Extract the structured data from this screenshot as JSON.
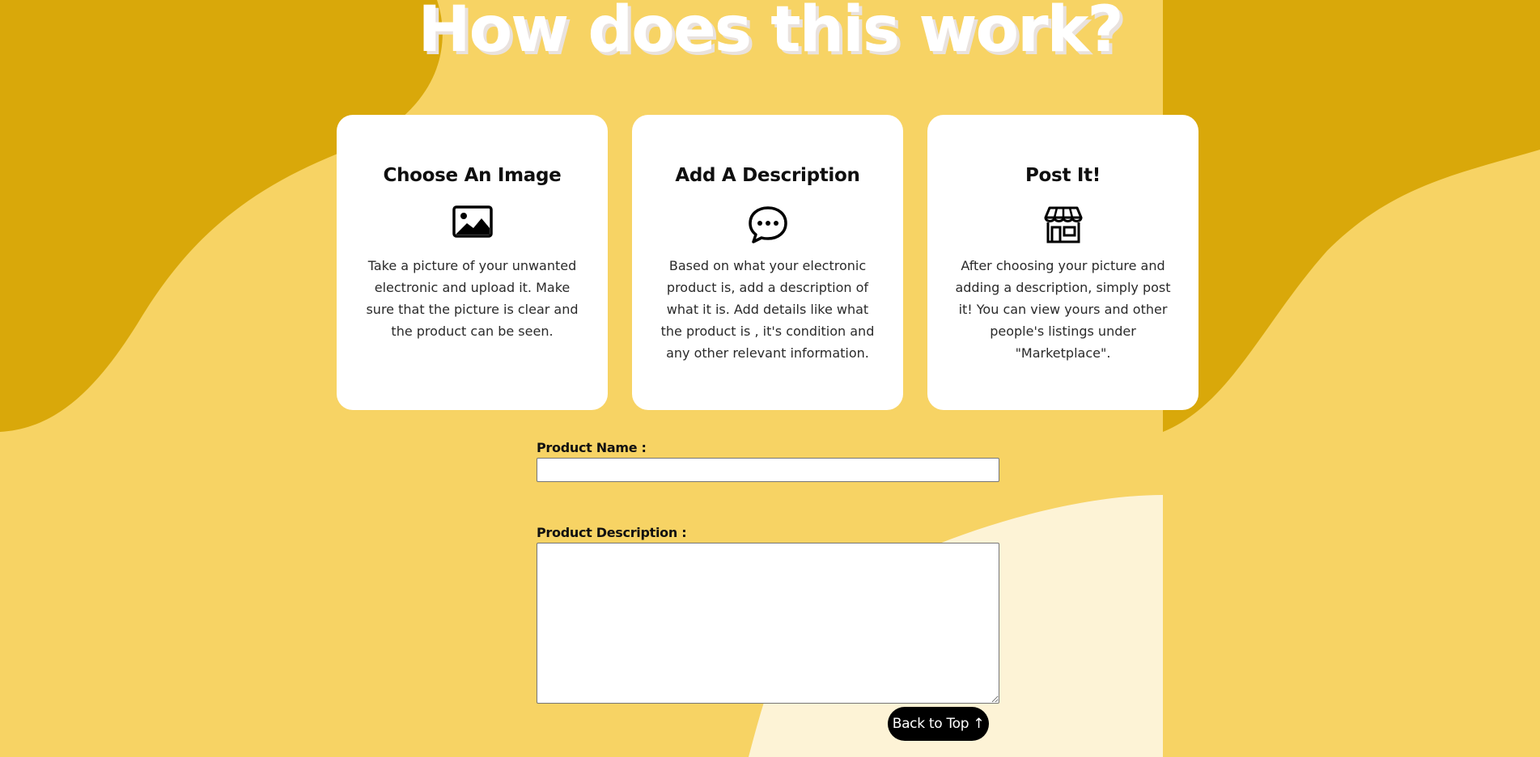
{
  "page": {
    "title": "How does this work?"
  },
  "colors": {
    "background": "#f7d364",
    "dark_blob": "#d9a80a",
    "light_blob": "#fdf3d6",
    "card": "#ffffff",
    "button": "#000000"
  },
  "steps": [
    {
      "title": "Choose An Image",
      "icon": "image-icon",
      "description": "Take a picture of your unwanted electronic and upload it. Make sure that the picture is clear and the product can be seen."
    },
    {
      "title": "Add A Description",
      "icon": "chat-bubble-icon",
      "description": "Based on what your electronic product is, add a description of what it is. Add details like what the product is , it's condition and any other relevant information."
    },
    {
      "title": "Post It!",
      "icon": "storefront-icon",
      "description": "After choosing your picture and adding a description, simply post it! You can view yours and other people's listings under \"Marketplace\"."
    }
  ],
  "form": {
    "product_name_label": "Product Name :",
    "product_name_value": "",
    "product_description_label": "Product Description :",
    "product_description_value": ""
  },
  "back_to_top": {
    "label": "Back to Top ↑"
  }
}
